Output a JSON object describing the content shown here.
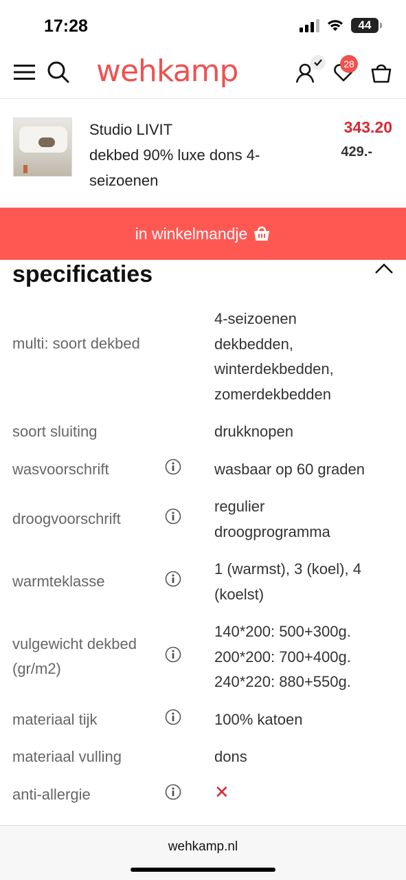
{
  "status": {
    "time": "17:28",
    "battery": "44"
  },
  "header": {
    "logo": "wehkamp",
    "favorites_count": "28",
    "icons": [
      "menu-icon",
      "search-icon",
      "account-icon",
      "heart-icon",
      "basket-icon"
    ]
  },
  "product": {
    "brand": "Studio LIVIT",
    "name": "dekbed 90% luxe dons 4-seizoenen",
    "price_new": "343.20",
    "price_old": "429.-"
  },
  "cart_button": {
    "label": "in winkelmandje"
  },
  "specs": {
    "title": "specificaties",
    "rows": [
      {
        "label": "multi: soort dekbed",
        "value": "4-seizoenen dekbedden, winterdekbedden, zomerdekbedden",
        "info": false
      },
      {
        "label": "soort sluiting",
        "value": "drukknopen",
        "info": false
      },
      {
        "label": "wasvoorschrift",
        "value": "wasbaar op 60 graden",
        "info": true
      },
      {
        "label": "droogvoorschrift",
        "value": "regulier droogprogramma",
        "info": true
      },
      {
        "label": "warmteklasse",
        "value": "1 (warmst), 3 (koel), 4 (koelst)",
        "info": true
      },
      {
        "label": "vulgewicht dekbed (gr/m2)",
        "value": "140*200: 500+300g. 200*200: 700+400g. 240*220: 880+550g.",
        "info": true
      },
      {
        "label": "materiaal tijk",
        "value": "100% katoen",
        "info": true
      },
      {
        "label": "materiaal vulling",
        "value": "dons",
        "info": false
      },
      {
        "label": "anti-allergie",
        "value": "✕",
        "info": true
      }
    ]
  },
  "browser": {
    "url": "wehkamp.nl"
  },
  "colors": {
    "brand": "#ee5250",
    "cart_button": "#ff5853",
    "price": "#d42a33"
  }
}
